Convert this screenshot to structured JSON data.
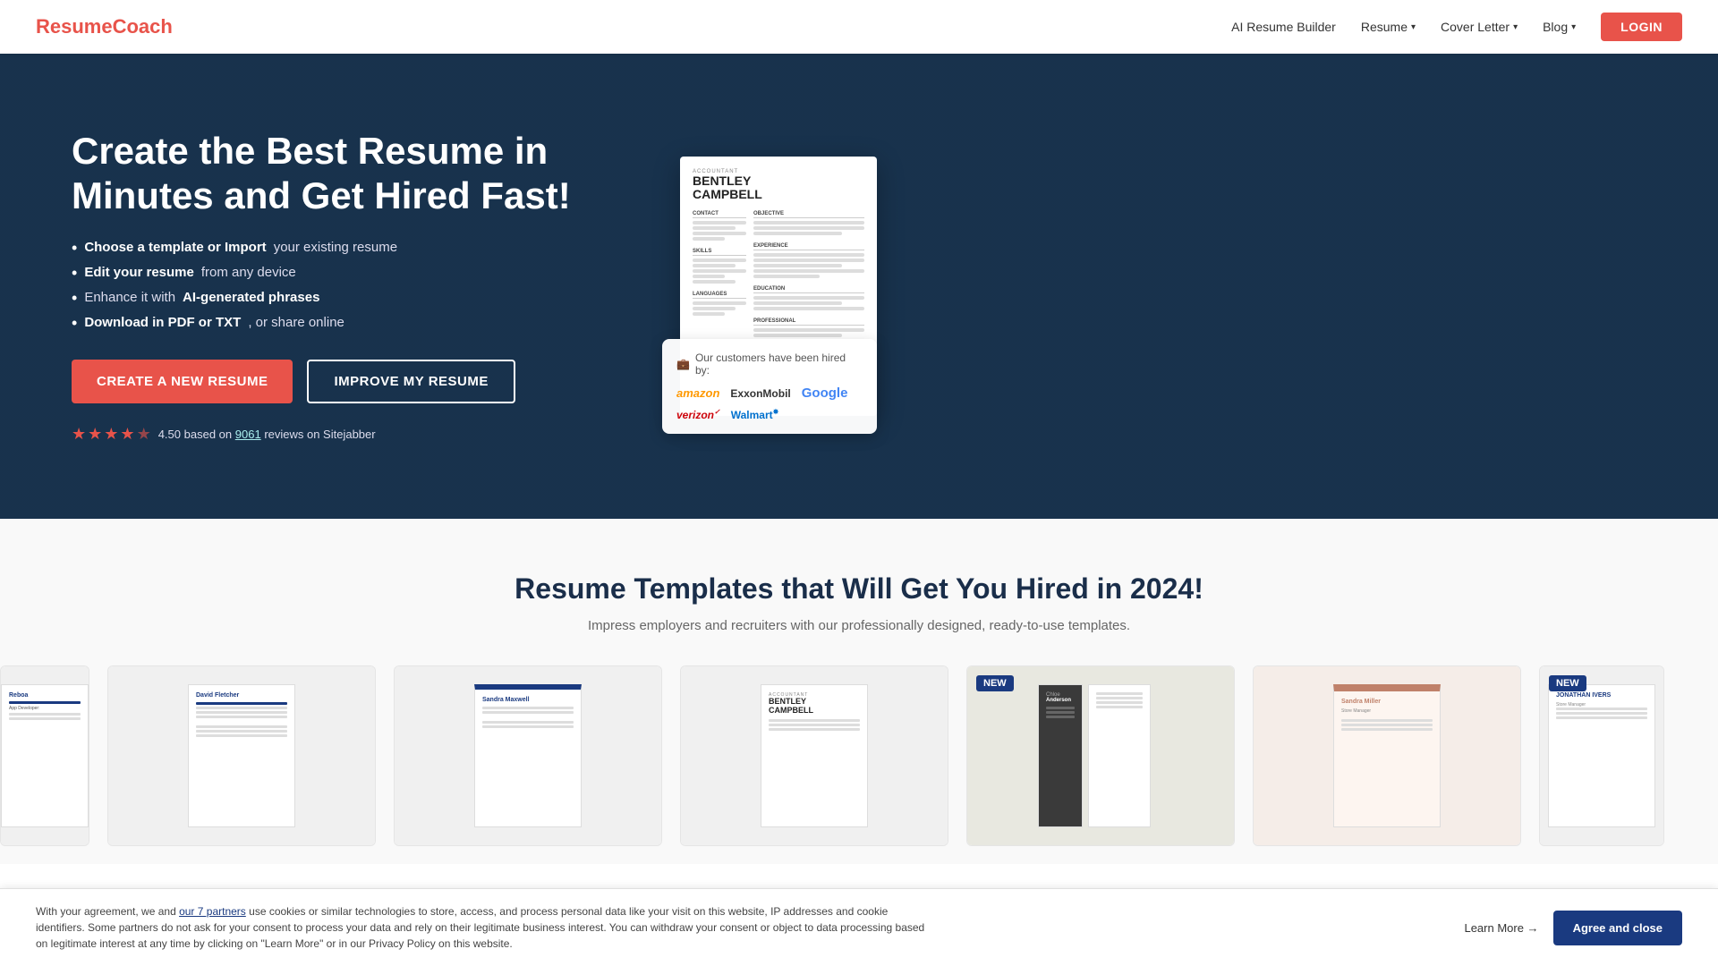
{
  "brand": {
    "name_prefix": "Resume",
    "name_suffix": "Coach"
  },
  "navbar": {
    "ai_builder": "AI Resume Builder",
    "resume": "Resume",
    "cover_letter": "Cover Letter",
    "blog": "Blog",
    "login": "LOGIN"
  },
  "hero": {
    "title": "Create the Best Resume in Minutes and Get Hired Fast!",
    "bullets": [
      {
        "bold": "Choose a template or Import",
        "rest": " your existing resume"
      },
      {
        "bold": "Edit your resume",
        "rest": " from any device"
      },
      {
        "bold": "",
        "rest": "Enhance it with ",
        "bold2": "AI-generated phrases"
      },
      {
        "bold": "Download in PDF or TXT",
        "rest": ", or share online"
      }
    ],
    "btn_create": "CREATE A NEW RESUME",
    "btn_improve": "IMPROVE MY RESUME",
    "rating_score": "4.50",
    "rating_text": "based on",
    "rating_count": "9061",
    "rating_platform": "reviews on Sitejabber"
  },
  "resume_preview": {
    "label": "ACCOUNTANT",
    "name": "BENTLEY\nCAMPBELL"
  },
  "hired_by": {
    "title": "Our customers have been hired by:",
    "companies": [
      "amazon",
      "ExxonMobil",
      "Google",
      "verizon✓",
      "Walmart✸"
    ]
  },
  "templates_section": {
    "title": "Resume Templates that Will Get You Hired in 2024!",
    "subtitle": "Impress employers and recruiters with our professionally designed, ready-to-use templates.",
    "templates": [
      {
        "name": "David Fletcher",
        "new": false
      },
      {
        "name": "Sandra Maxwell",
        "new": false
      },
      {
        "name": "Bentley Campbell",
        "new": false
      },
      {
        "name": "Chloe Anderson",
        "new": true
      },
      {
        "name": "Sandra Miller",
        "new": false
      },
      {
        "name": "Jonathan Ivers",
        "new": true
      }
    ]
  },
  "cookie": {
    "text_prefix": "With your agreement, we and ",
    "link_text": "our 7 partners",
    "text_suffix": " use cookies or similar technologies to store, access, and process personal data like your visit on this website, IP addresses and cookie identifiers. Some partners do not ask for your consent to process your data and rely on their legitimate business interest. You can withdraw your consent or object to data processing based on legitimate interest at any time by clicking on \"Learn More\" or in our Privacy Policy on this website.",
    "learn_more": "Learn More →",
    "agree": "Agree and close"
  }
}
